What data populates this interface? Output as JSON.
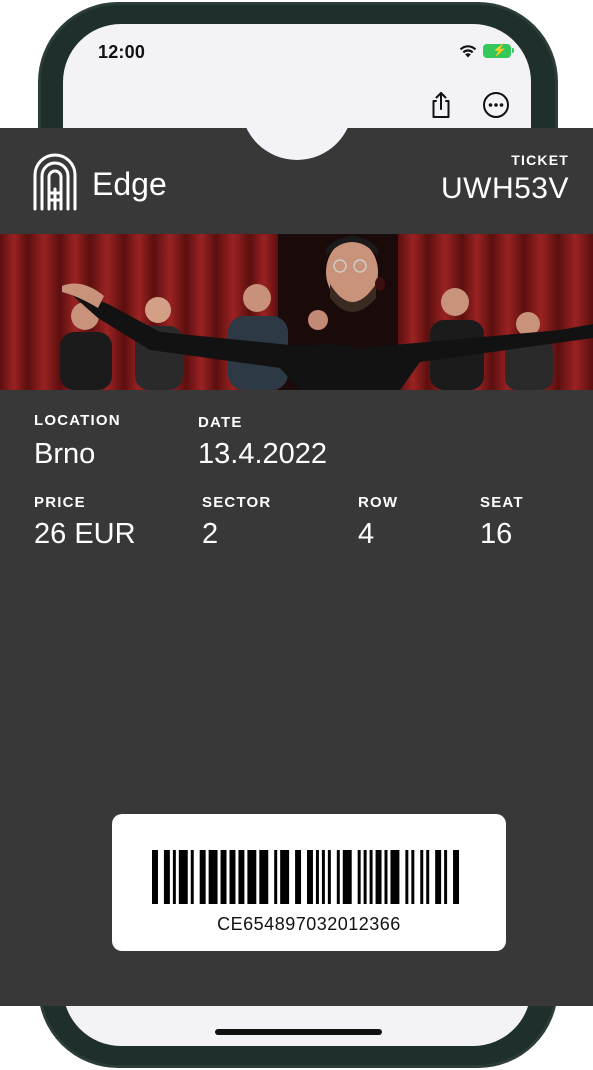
{
  "status_bar": {
    "time": "12:00"
  },
  "toolbar": {
    "share_icon": "share-icon",
    "more_icon": "more-icon"
  },
  "ticket": {
    "brand": "Edge",
    "ticket_label": "TICKET",
    "ticket_code": "UWH53V",
    "fields": {
      "location": {
        "label": "LOCATION",
        "value": "Brno"
      },
      "date": {
        "label": "DATE",
        "value": "13.4.2022"
      },
      "price": {
        "label": "PRICE",
        "value": "26 EUR"
      },
      "sector": {
        "label": "SECTOR",
        "value": "2"
      },
      "row": {
        "label": "ROW",
        "value": "4"
      },
      "seat": {
        "label": "SEAT",
        "value": "16"
      }
    },
    "barcode": {
      "value": "CE654897032012366"
    }
  },
  "colors": {
    "card_bg": "#383838",
    "battery": "#34c759",
    "curtain": "#7a1818"
  }
}
